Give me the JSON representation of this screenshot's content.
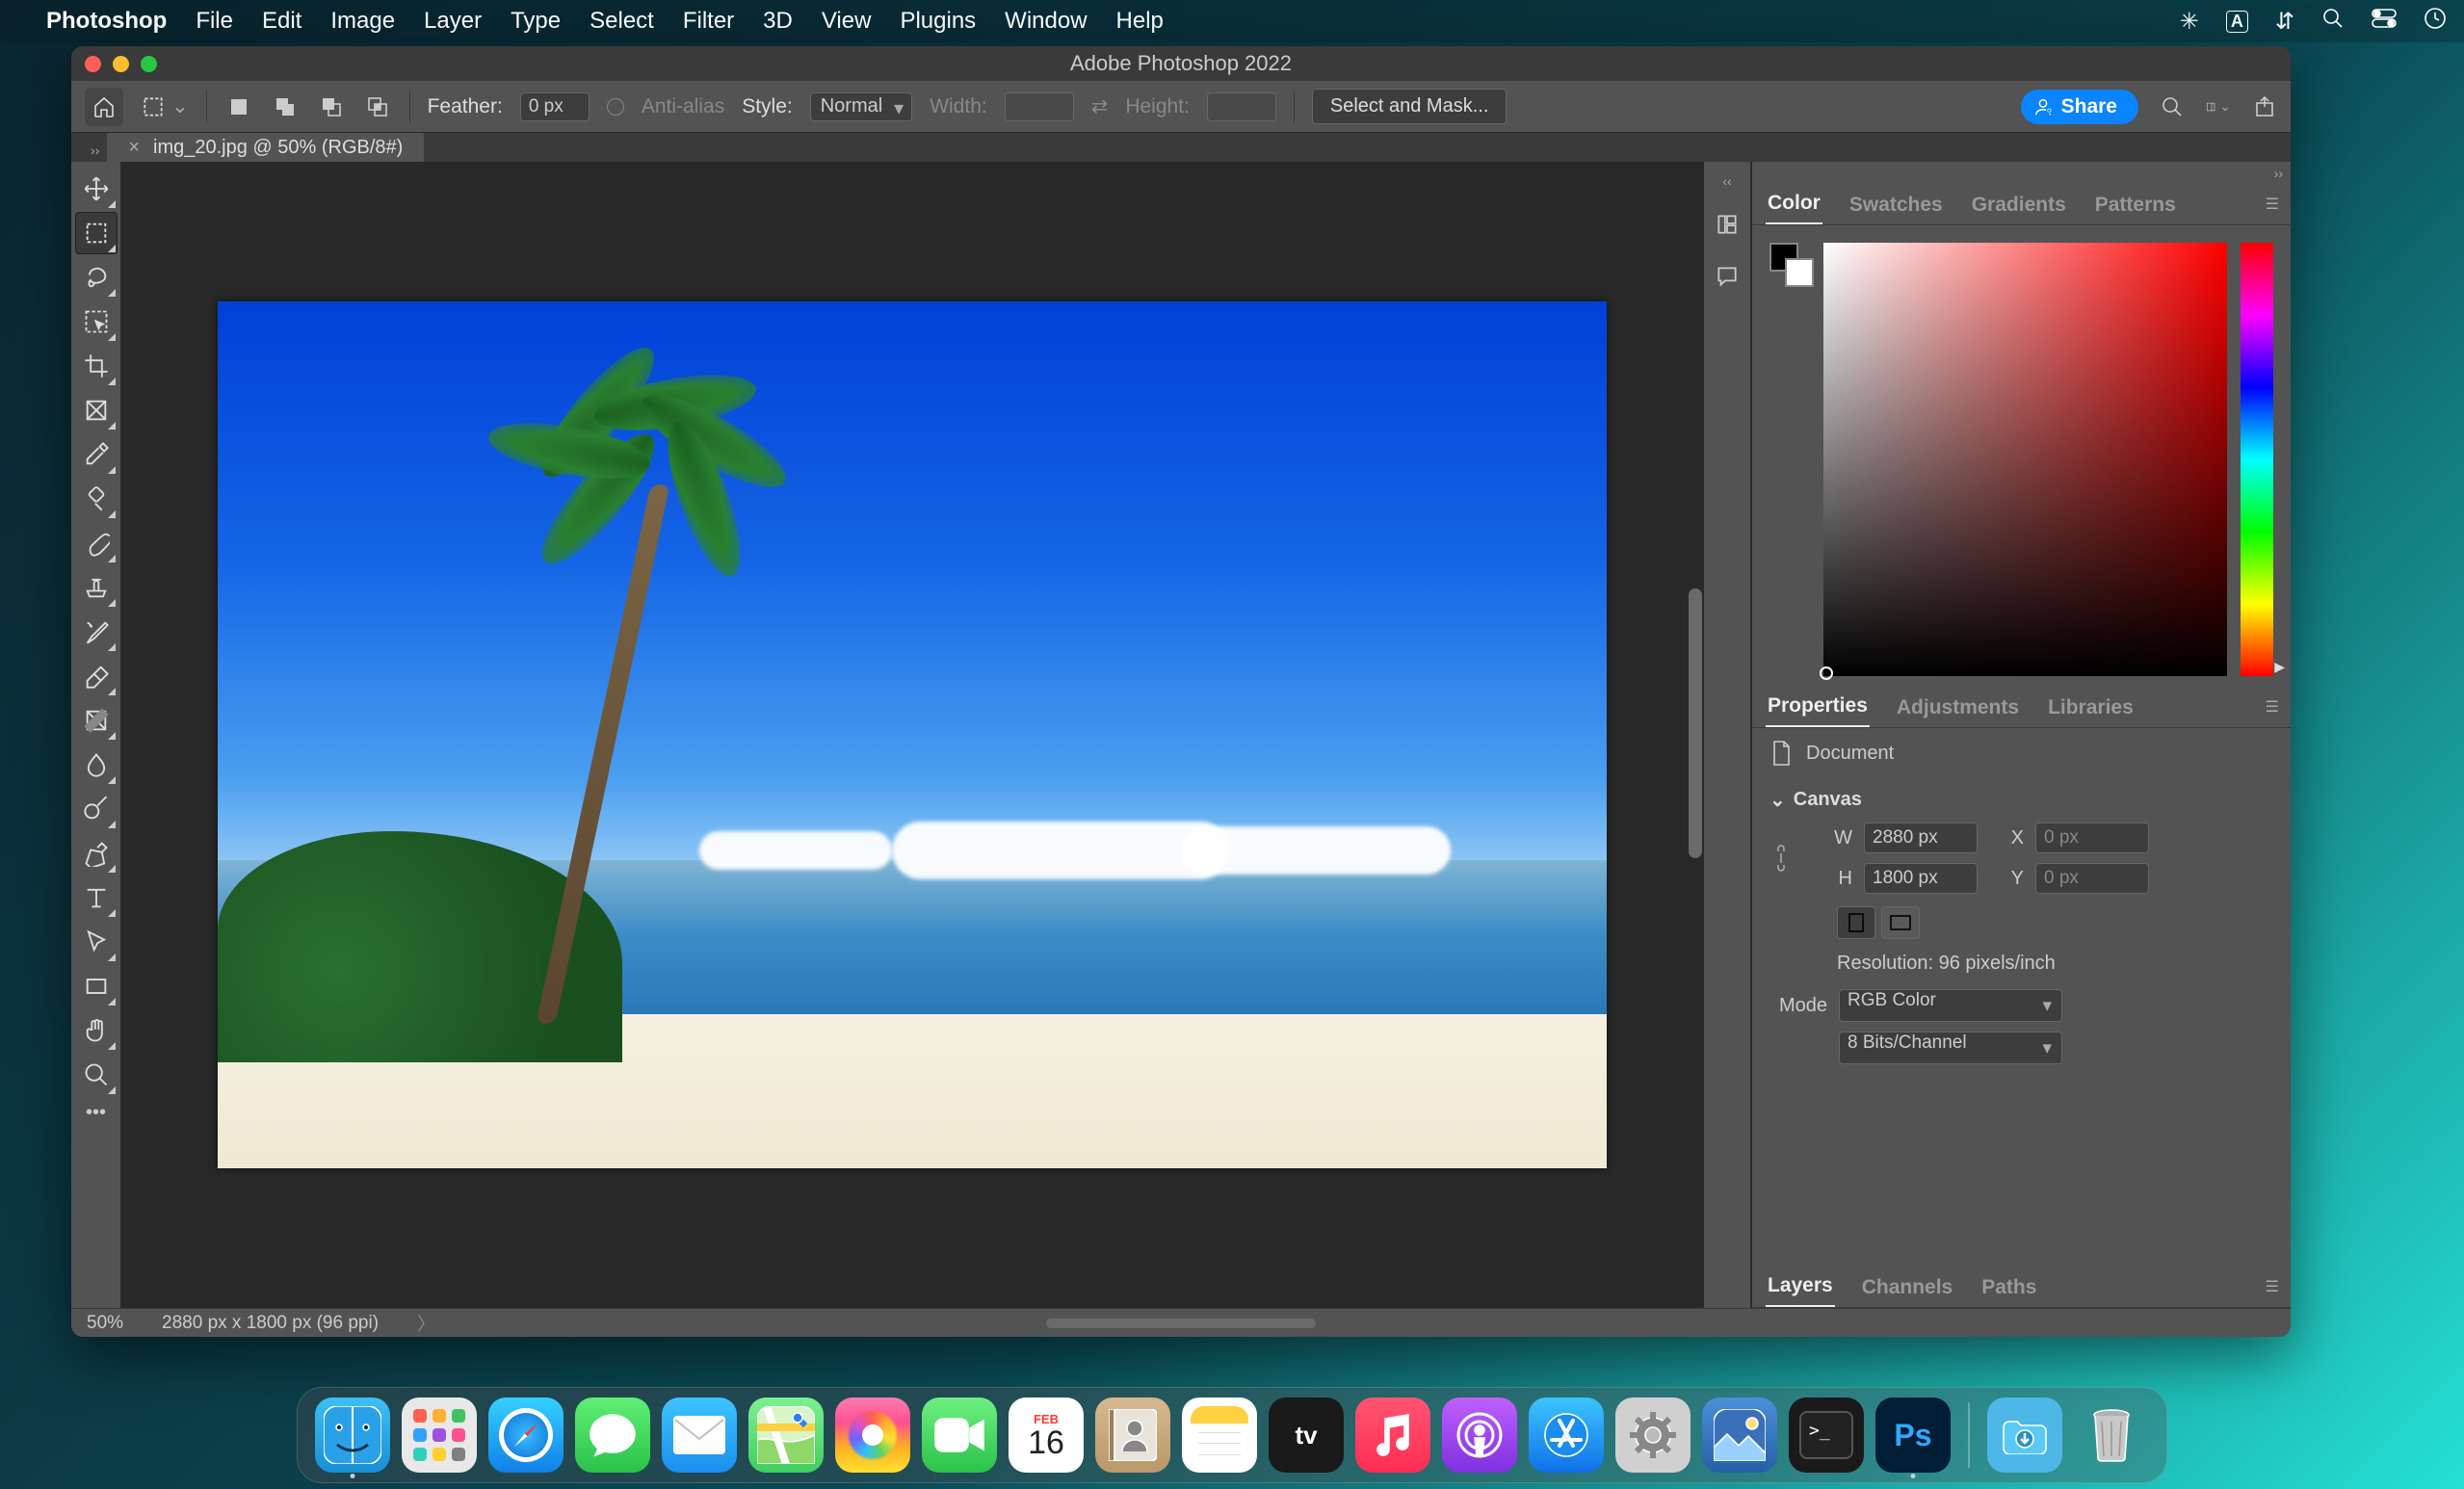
{
  "menubar": {
    "app_name": "Photoshop",
    "items": [
      "File",
      "Edit",
      "Image",
      "Layer",
      "Type",
      "Select",
      "Filter",
      "3D",
      "View",
      "Plugins",
      "Window",
      "Help"
    ]
  },
  "window": {
    "title": "Adobe Photoshop 2022"
  },
  "options": {
    "feather_label": "Feather:",
    "feather_value": "0 px",
    "antialias_label": "Anti-alias",
    "style_label": "Style:",
    "style_value": "Normal",
    "width_label": "Width:",
    "width_value": "",
    "height_label": "Height:",
    "height_value": "",
    "mask_button": "Select and Mask...",
    "share_label": "Share"
  },
  "document_tab": {
    "label": "img_20.jpg @ 50% (RGB/8#)"
  },
  "panels": {
    "color_tabs": [
      "Color",
      "Swatches",
      "Gradients",
      "Patterns"
    ],
    "properties_tabs": [
      "Properties",
      "Adjustments",
      "Libraries"
    ],
    "layers_tabs": [
      "Layers",
      "Channels",
      "Paths"
    ],
    "doc_label": "Document",
    "canvas_label": "Canvas",
    "w_label": "W",
    "w_value": "2880 px",
    "h_label": "H",
    "h_value": "1800 px",
    "x_label": "X",
    "x_value": "0 px",
    "y_label": "Y",
    "y_value": "0 px",
    "resolution_text": "Resolution: 96 pixels/inch",
    "mode_label": "Mode",
    "mode_value": "RGB Color",
    "depth_value": "8 Bits/Channel"
  },
  "status": {
    "zoom": "50%",
    "dims": "2880 px x 1800 px (96 ppi)"
  },
  "dock_apps": [
    "Finder",
    "Launchpad",
    "Safari",
    "Messages",
    "Mail",
    "Maps",
    "Photos",
    "FaceTime",
    "Calendar",
    "Contacts",
    "Notes",
    "TV",
    "Music",
    "Podcasts",
    "App Store",
    "System Preferences",
    "Wallpaper",
    "Terminal",
    "Photoshop"
  ],
  "dock_calendar": {
    "month": "FEB",
    "day": "16"
  }
}
